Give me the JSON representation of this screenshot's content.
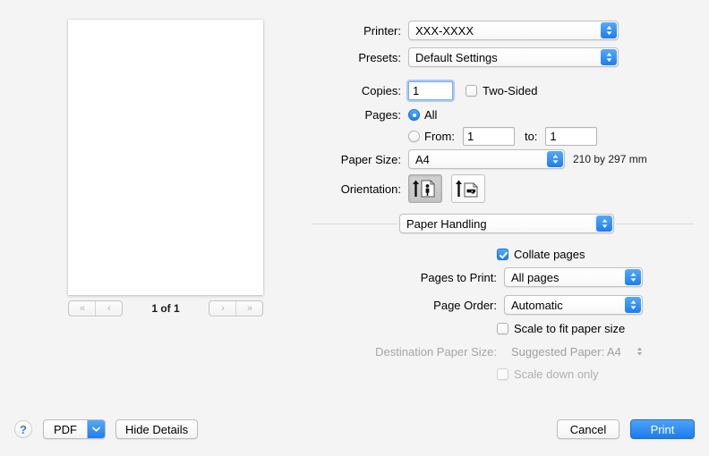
{
  "preview": {
    "page_counter": "1 of 1",
    "nav": {
      "first": "«",
      "prev": "‹",
      "next": "›",
      "last": "»"
    }
  },
  "settings": {
    "printer": {
      "label": "Printer:",
      "value": "XXX-XXXX"
    },
    "presets": {
      "label": "Presets:",
      "value": "Default Settings"
    },
    "copies": {
      "label": "Copies:",
      "value": "1"
    },
    "two_sided": {
      "label": "Two-Sided",
      "checked": false
    },
    "pages": {
      "label": "Pages:",
      "all_label": "All",
      "from_label": "From:",
      "from_value": "1",
      "to_label": "to:",
      "to_value": "1",
      "selected": "all"
    },
    "paper_size": {
      "label": "Paper Size:",
      "value": "A4",
      "dimensions": "210 by 297 mm"
    },
    "orientation": {
      "label": "Orientation:",
      "portrait_name": "portrait",
      "landscape_name": "landscape",
      "selected": "portrait"
    }
  },
  "pane": {
    "selector": {
      "value": "Paper Handling"
    },
    "collate": {
      "label": "Collate pages",
      "checked": true
    },
    "pages_to_print": {
      "label": "Pages to Print:",
      "value": "All pages"
    },
    "page_order": {
      "label": "Page Order:",
      "value": "Automatic"
    },
    "scale_to_fit": {
      "label": "Scale to fit paper size",
      "checked": false
    },
    "destination_paper_size": {
      "label": "Destination Paper Size:",
      "value": "Suggested Paper: A4",
      "disabled": true
    },
    "scale_down_only": {
      "label": "Scale down only",
      "checked": false,
      "disabled": true
    }
  },
  "bottom": {
    "help": "?",
    "pdf": "PDF",
    "hide_details": "Hide Details",
    "cancel": "Cancel",
    "print": "Print"
  },
  "colors": {
    "accent_blue": "#1d7df2",
    "window_bg": "#f4f4f4",
    "disabled_text": "#a0a0a0"
  }
}
